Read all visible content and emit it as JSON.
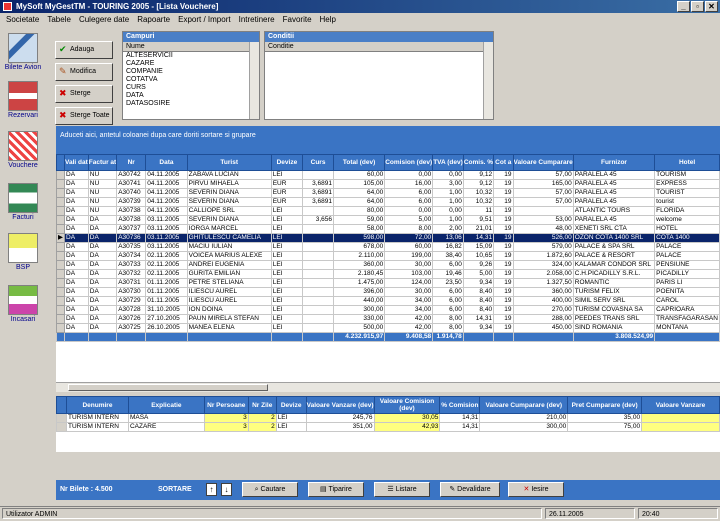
{
  "window": {
    "title": "MySoft MyGestTM  -  TOURING 2005 - [Lista Vouchere]",
    "controls": [
      "_",
      "▫",
      "✕"
    ]
  },
  "menu": [
    "Societate",
    "Tabele",
    "Culegere date",
    "Rapoarte",
    "Export / Import",
    "Intretinere",
    "Favorite",
    "Help"
  ],
  "sidebar": [
    {
      "label": "Bilete Avion",
      "icon": "airplane-icon"
    },
    {
      "label": "Rezervari",
      "icon": "reservations-icon"
    },
    {
      "label": "Vouchere",
      "icon": "voucher-icon"
    },
    {
      "label": "Facturi",
      "icon": "invoice-icon"
    },
    {
      "label": "BSP",
      "icon": "bsp-icon"
    },
    {
      "label": "Incasari",
      "icon": "receipts-icon"
    }
  ],
  "actions": {
    "add": "Adauga",
    "edit": "Modifica",
    "delete": "Sterge",
    "delete_all": "Sterge Toate"
  },
  "fields_panel": {
    "title": "Campuri",
    "column": "Nume",
    "items": [
      "ALTESERVICII",
      "CAZARE",
      "COMPANIE",
      "COTATVA",
      "CURS",
      "DATA",
      "DATASOSIRE"
    ]
  },
  "conditions_panel": {
    "title": "Conditii",
    "column": "Conditie"
  },
  "grid": {
    "banner": "Aduceti aici, antetul coloanei dupa care doriti sortare si grupare",
    "columns": [
      "Vali dat",
      "Factur at",
      "Nr",
      "Data",
      "Turist",
      "Devize",
      "Curs",
      "Total (dev)",
      "Comision (dev)",
      "TVA (dev)",
      "Comis. %",
      "Cot a",
      "Valoare Cumparare",
      "Furnizor",
      "Hotel"
    ],
    "rows": [
      [
        "DA",
        "NU",
        "A30742",
        "04.11.2005",
        "ZABAVA LUCIAN",
        "LEI",
        "",
        "60,00",
        "0,00",
        "0,00",
        "9,12",
        "19",
        "57,00",
        "PARALELA 45",
        "TOURISM"
      ],
      [
        "DA",
        "NU",
        "A30741",
        "04.11.2005",
        "PIRVU MIHAELA",
        "EUR",
        "3,6891",
        "105,00",
        "16,00",
        "3,00",
        "9,12",
        "19",
        "165,00",
        "PARALELA 45",
        "EXPRESS"
      ],
      [
        "DA",
        "NU",
        "A30740",
        "04.11.2005",
        "SEVERIN DIANA",
        "EUR",
        "3,6891",
        "64,00",
        "6,00",
        "1,00",
        "10,32",
        "19",
        "57,00",
        "PARALELA 45",
        "TOURIST"
      ],
      [
        "DA",
        "NU",
        "A30739",
        "04.11.2005",
        "SEVERIN DIANA",
        "EUR",
        "3,6891",
        "64,00",
        "6,00",
        "1,00",
        "10,32",
        "19",
        "57,00",
        "PARALELA 45",
        "tourist"
      ],
      [
        "DA",
        "NU",
        "A30738",
        "04.11.2005",
        "CALLIOPE SRL",
        "LEI",
        "",
        "80,00",
        "0,00",
        "0,00",
        "11",
        "19",
        "",
        "ATLANTIC TOURS",
        "FLORIDA"
      ],
      [
        "DA",
        "DA",
        "A30738",
        "03.11.2005",
        "SEVERIN DIANA",
        "LEI",
        "3,656",
        "59,00",
        "5,00",
        "1,00",
        "9,51",
        "19",
        "53,00",
        "PARALELA 45",
        "welcome"
      ],
      [
        "DA",
        "DA",
        "A30737",
        "03.11.2005",
        "IORGA MARCEL",
        "LEI",
        "",
        "58,00",
        "8,00",
        "2,00",
        "21,01",
        "19",
        "48,00",
        "XENETI SRL CTA",
        "HOTEL"
      ],
      [
        "DA",
        "DA",
        "A30736",
        "03.11.2005",
        "GHITULESCU CAMELIA",
        "LEI",
        "",
        "598,00",
        "72,00",
        "13,06",
        "14,31",
        "19",
        "526,00",
        "OZON COTA 1400 SRL",
        "COTA 1400"
      ],
      [
        "DA",
        "DA",
        "A30735",
        "03.11.2005",
        "MACIU IULIAN",
        "LEI",
        "",
        "678,00",
        "60,00",
        "16,82",
        "15,09",
        "19",
        "579,00",
        "PALACE & SPA SRL",
        "PALACE"
      ],
      [
        "DA",
        "DA",
        "A30734",
        "02.11.2005",
        "VOICEA MARIUS ALEXE",
        "LEI",
        "",
        "2.110,00",
        "199,00",
        "38,40",
        "10,65",
        "19",
        "1.872,60",
        "PALACE & RESORT",
        "PALACE"
      ],
      [
        "DA",
        "DA",
        "A30733",
        "02.11.2005",
        "ANDREI EUGENIA",
        "LEI",
        "",
        "360,00",
        "30,00",
        "6,00",
        "9,26",
        "19",
        "324,00",
        "KALAMAR CONDOR SRL",
        "PENSIUNE"
      ],
      [
        "DA",
        "DA",
        "A30732",
        "02.11.2005",
        "GURITA EMILIAN",
        "LEI",
        "",
        "2.180,45",
        "103,00",
        "19,46",
        "5,00",
        "19",
        "2.058,00",
        "C.H.PICADILLY S.R.L.",
        "PICADILLY"
      ],
      [
        "DA",
        "DA",
        "A30731",
        "01.11.2005",
        "PETRE STELIANA",
        "LEI",
        "",
        "1.475,00",
        "124,00",
        "23,50",
        "9,34",
        "19",
        "1.327,50",
        "ROMANTIC",
        "PARIS LI"
      ],
      [
        "DA",
        "DA",
        "A30730",
        "01.11.2005",
        "ILIESCU AUREL",
        "LEI",
        "",
        "396,00",
        "30,00",
        "6,00",
        "8,40",
        "19",
        "360,00",
        "TURISM FELIX",
        "POENITA"
      ],
      [
        "DA",
        "DA",
        "A30729",
        "01.11.2005",
        "ILIESCU AUREL",
        "LEI",
        "",
        "440,00",
        "34,00",
        "6,00",
        "8,40",
        "19",
        "400,00",
        "SIMIL SERV SRL",
        "CAROL"
      ],
      [
        "DA",
        "DA",
        "A30728",
        "31.10.2005",
        "ION DOINA",
        "LEI",
        "",
        "300,00",
        "34,00",
        "6,00",
        "8,40",
        "19",
        "270,00",
        "TURISM COVASNA SA",
        "CAPRIOARA"
      ],
      [
        "DA",
        "DA",
        "A30726",
        "27.10.2005",
        "PAUN MIRELA STEFAN",
        "LEI",
        "",
        "330,00",
        "42,00",
        "8,00",
        "14,31",
        "19",
        "288,00",
        "PEEDES TRANS SRL",
        "TRANSFAGARASAN"
      ],
      [
        "DA",
        "DA",
        "A30725",
        "26.10.2005",
        "MANEA ELENA",
        "LEI",
        "",
        "500,00",
        "42,00",
        "8,00",
        "9,34",
        "19",
        "450,00",
        "SIND ROMANIA",
        "MONTANA"
      ]
    ],
    "selected_row": 7,
    "totals": {
      "total": "4.232.915,97",
      "commission": "9.408,58",
      "tva": "1.914,78",
      "purchase": "3.808.524,99"
    }
  },
  "subgrid": {
    "columns": [
      "Denumire",
      "Explicatie",
      "Nr Persoane",
      "Nr Zile",
      "Devize",
      "Valoare Vanzare (dev)",
      "Valoare Comision (dev)",
      "% Comision",
      "Valoare Cumparare (dev)",
      "Pret Cumparare (dev)",
      "Valoare Vanzare"
    ],
    "rows": [
      [
        "TURISM INTERN",
        "MASA",
        "3",
        "2",
        "LEI",
        "245,76",
        "30,05",
        "14,31",
        "210,00",
        "35,00",
        ""
      ],
      [
        "TURISM INTERN",
        "CAZARE",
        "3",
        "2",
        "LEI",
        "351,00",
        "42,93",
        "14,31",
        "300,00",
        "75,00",
        ""
      ]
    ]
  },
  "footer": {
    "count": "Nr Bilete : 4.500",
    "sort_label": "SORTARE",
    "sort_up": "↑",
    "sort_down": "↓",
    "buttons": [
      "Cautare",
      "Tiparire",
      "Listare",
      "Devalidare",
      "Iesire"
    ]
  },
  "status": {
    "user": "Utilizator ADMIN",
    "date": "26.11.2005",
    "time": "20:40"
  }
}
